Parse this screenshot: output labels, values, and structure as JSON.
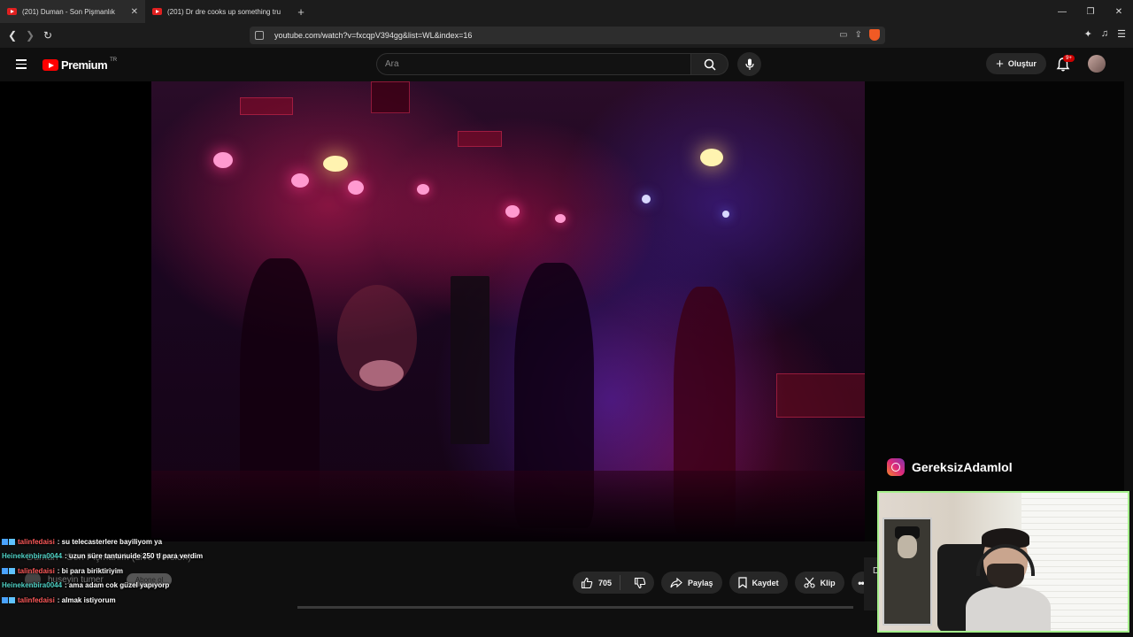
{
  "browser": {
    "tabs": [
      {
        "title": "(201) Duman - Son Pişmanlık",
        "active": true
      },
      {
        "title": "(201) Dr dre cooks up something tru",
        "active": false
      }
    ],
    "url": "youtube.com/watch?v=fxcqpV394gg&list=WL&index=16"
  },
  "youtube": {
    "logo_text": "Premium",
    "logo_region": "TR",
    "search_placeholder": "Ara",
    "create_label": "Oluştur",
    "notification_badge": "9+"
  },
  "video": {
    "title": "Duman - Son Pişmanlık (Live Version)",
    "channel": "huseyin tumer",
    "subscribe_label": "Abone ol",
    "likes": "705",
    "actions": {
      "share": "Paylaş",
      "save": "Kaydet",
      "clip": "Klip"
    }
  },
  "overlay": {
    "instagram_handle": "GereksizAdamlol",
    "chat": [
      {
        "user": "talinfedaisi",
        "user_color": "#ff5a5a",
        "message": ": su telecasterlere bayiliyom ya"
      },
      {
        "user": "Heinekenbira0044",
        "user_color": "#4fd1c5",
        "message": ": uzun süre tantunuide 250 tl para verdim"
      },
      {
        "user": "talinfedaisi",
        "user_color": "#ff5a5a",
        "message": ": bi para biriktiriyim"
      },
      {
        "user": "Heinekenbira0044",
        "user_color": "#4fd1c5",
        "message": ": ama adam cok güzel yapıyorp"
      },
      {
        "user": "talinfedaisi",
        "user_color": "#ff5a5a",
        "message": ": almak istiyorum"
      }
    ]
  },
  "colors": {
    "youtube_red": "#ff0000",
    "webcam_border": "#a6f08c"
  }
}
